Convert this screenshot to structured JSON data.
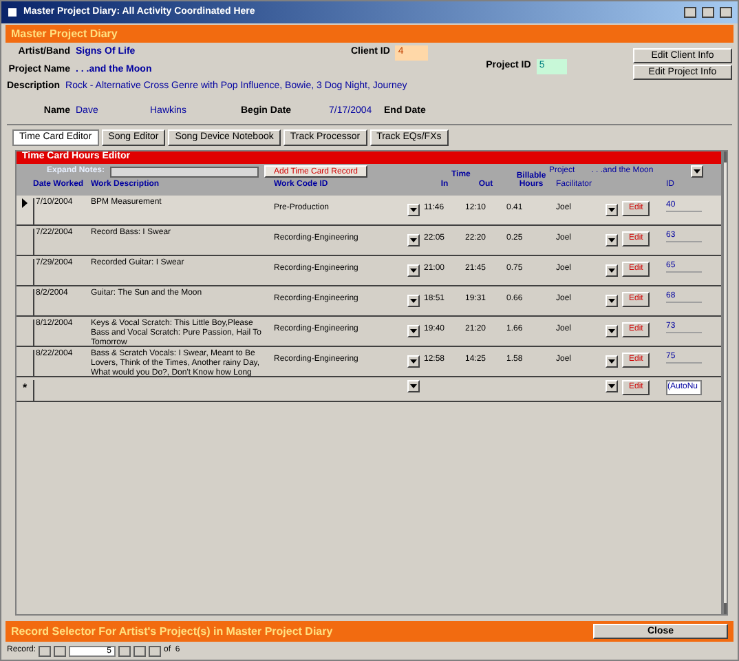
{
  "window": {
    "title": "Master Project Diary: All Activity Coordinated Here"
  },
  "header": {
    "title": "Master Project Diary"
  },
  "info": {
    "artist_label": "Artist/Band",
    "artist": "Signs Of Life",
    "project_label": "Project Name",
    "project": ". . .and the Moon",
    "description_label": "Description",
    "description": "Rock - Alternative Cross Genre with Pop Influence, Bowie, 3 Dog Night, Journey",
    "client_id_label": "Client ID",
    "client_id": "4",
    "project_id_label": "Project ID",
    "project_id": "5",
    "name_label": "Name",
    "first_name": "Dave",
    "last_name": "Hawkins",
    "begin_label": "Begin Date",
    "begin_date": "7/17/2004",
    "end_label": "End Date"
  },
  "buttons": [
    "Edit Client Info",
    "Edit Project Info"
  ],
  "tabs": [
    {
      "label": "Time Card Editor",
      "selected": true
    },
    {
      "label": "Song Editor",
      "selected": false
    },
    {
      "label": "Song Device Notebook",
      "selected": false
    },
    {
      "label": "Track Processor",
      "selected": false
    },
    {
      "label": "Track EQs/FXs",
      "selected": false
    }
  ],
  "subform": {
    "title": "Time Card Hours Editor",
    "expand_label": "Expand Notes:",
    "add_button": "Add Time Card Record",
    "project_label": "Project",
    "project_value": ". . .and the Moon",
    "columns": {
      "date": "Date Worked",
      "description": "Work Description",
      "work_code": "Work Code ID",
      "time": "Time",
      "in": "In",
      "out": "Out",
      "hours": "Billable Hours",
      "facilitator": "Facilitator",
      "id": "ID"
    },
    "rows": [
      {
        "selected": true,
        "date": "7/10/2004",
        "description": "BPM Measurement",
        "work_code": "Pre-Production",
        "in": "11:46",
        "out": "12:10",
        "hours": "0.41",
        "facilitator": "Joel",
        "edit": "Edit",
        "id": "40"
      },
      {
        "selected": false,
        "date": "7/22/2004",
        "description": "Record Bass: I Swear",
        "work_code": "Recording-Engineering",
        "in": "22:05",
        "out": "22:20",
        "hours": "0.25",
        "facilitator": "Joel",
        "edit": "Edit",
        "id": "63"
      },
      {
        "selected": false,
        "date": "7/29/2004",
        "description": "Recorded Guitar: I Swear",
        "work_code": "Recording-Engineering",
        "in": "21:00",
        "out": "21:45",
        "hours": "0.75",
        "facilitator": "Joel",
        "edit": "Edit",
        "id": "65"
      },
      {
        "selected": false,
        "date": "8/2/2004",
        "description": "Guitar: The Sun and the Moon",
        "work_code": "Recording-Engineering",
        "in": "18:51",
        "out": "19:31",
        "hours": "0.66",
        "facilitator": "Joel",
        "edit": "Edit",
        "id": "68"
      },
      {
        "selected": false,
        "date": "8/12/2004",
        "description": "Keys & Vocal Scratch: This Little Boy,Please Bass and Vocal Scratch: Pure Passion, Hail To Tomorrow",
        "work_code": "Recording-Engineering",
        "in": "19:40",
        "out": "21:20",
        "hours": "1.66",
        "facilitator": "Joel",
        "edit": "Edit",
        "id": "73"
      },
      {
        "selected": false,
        "date": "8/22/2004",
        "description": "Bass & Scratch Vocals: I Swear, Meant to Be Lovers, Think of the Times, Another rainy Day, What would you Do?, Don't Know how Long",
        "work_code": "Recording-Engineering",
        "in": "12:58",
        "out": "14:25",
        "hours": "1.58",
        "facilitator": "Joel",
        "edit": "Edit",
        "id": "75"
      }
    ],
    "new_row": {
      "marker": "*",
      "edit": "Edit",
      "id": "(AutoNu"
    }
  },
  "footer": {
    "title": "Record Selector For Artist's Project(s) in  Master Project Diary",
    "close": "Close"
  },
  "navigation": {
    "label": "Record:",
    "value": "5",
    "of": "of  6"
  }
}
